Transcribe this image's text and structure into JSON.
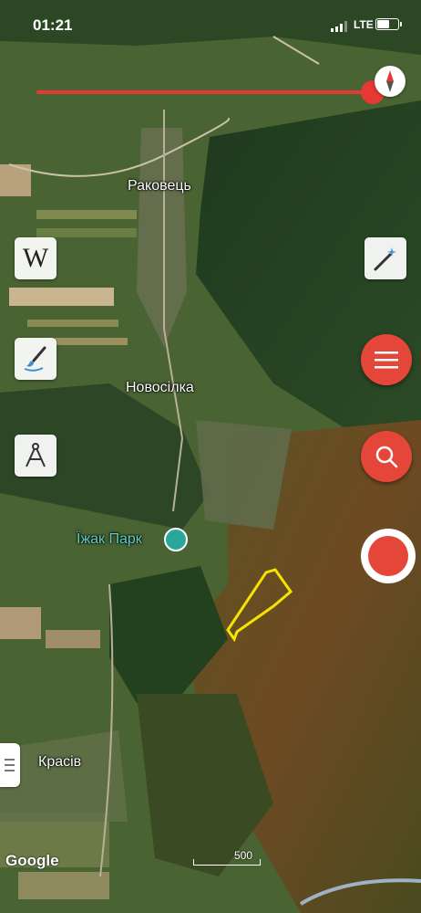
{
  "status_bar": {
    "time": "01:21",
    "network": "LTE",
    "battery_level": 0.6
  },
  "map": {
    "place_labels": [
      "Раковець",
      "Новосілка",
      "Красів"
    ],
    "poi_label": "Їжак Парк",
    "attribution": "Google",
    "scale_label": "500"
  },
  "toolbar": {
    "wikipedia_glyph": "W",
    "left_tools": [
      "wikipedia-icon",
      "paint-brush-icon",
      "drafting-compass-icon"
    ],
    "right_tools": [
      "magic-wand-icon",
      "menu-icon",
      "search-icon",
      "record-icon"
    ]
  },
  "colors": {
    "accent": "#e5463a",
    "area_outline": "#f5e400",
    "poi": "#2aa79b"
  }
}
